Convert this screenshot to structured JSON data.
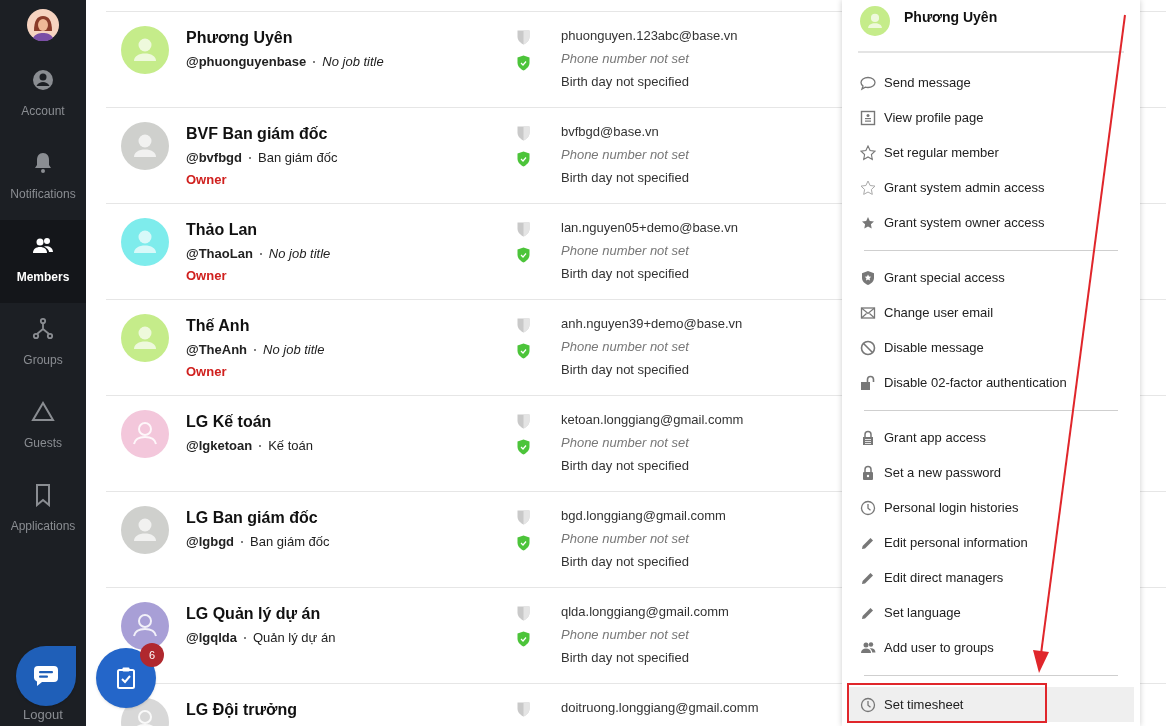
{
  "sidebar": {
    "items": [
      {
        "label": "Account",
        "selected": false
      },
      {
        "label": "Notifications",
        "selected": false
      },
      {
        "label": "Members",
        "selected": true
      },
      {
        "label": "Groups",
        "selected": false
      },
      {
        "label": "Guests",
        "selected": false
      },
      {
        "label": "Applications",
        "selected": false
      }
    ],
    "logout": "Logout"
  },
  "members": [
    {
      "name": "Phương Uyên",
      "handle": "@phuonguyenbase",
      "job_title": "No job title",
      "job_title_set": false,
      "color": "#c5ec8a",
      "kind": "filled",
      "email": "phuonguyen.123abc@base.vn",
      "phone": "Phone number not set",
      "phone_set": false,
      "birthday": "Birth day not specified"
    },
    {
      "name": "BVF Ban giám đốc",
      "handle": "@bvfbgd",
      "job_title": "Ban giám đốc",
      "job_title_set": true,
      "role": "Owner",
      "color": "#cfd0cd",
      "kind": "filled",
      "email": "bvfbgd@base.vn",
      "phone": "Phone number not set",
      "phone_set": false,
      "birthday": "Birth day not specified"
    },
    {
      "name": "Thảo Lan",
      "handle": "@ThaoLan",
      "job_title": "No job title",
      "job_title_set": false,
      "role": "Owner",
      "color": "#7eecec",
      "kind": "filled",
      "email": "lan.nguyen05+demo@base.vn",
      "phone": "Phone number not set",
      "phone_set": false,
      "birthday": "Birth day not specified"
    },
    {
      "name": "Thế Anh",
      "handle": "@TheAnh",
      "job_title": "No job title",
      "job_title_set": false,
      "role": "Owner",
      "color": "#c5ec8a",
      "kind": "filled",
      "email": "anh.nguyen39+demo@base.vn",
      "phone": "Phone number not set",
      "phone_set": false,
      "birthday": "Birth day not specified"
    },
    {
      "name": "LG Kế toán",
      "handle": "@lgketoan",
      "job_title": "Kế toán",
      "job_title_set": true,
      "color": "#f3c7db",
      "kind": "outline",
      "email": "ketoan.longgiang@gmail.comm",
      "phone": "Phone number not set",
      "phone_set": false,
      "birthday": "Birth day not specified"
    },
    {
      "name": "LG Ban giám đốc",
      "handle": "@lgbgd",
      "job_title": "Ban giám đốc",
      "job_title_set": true,
      "color": "#cfd0cd",
      "kind": "filled",
      "email": "bgd.longgiang@gmail.comm",
      "phone": "Phone number not set",
      "phone_set": false,
      "birthday": "Birth day not specified"
    },
    {
      "name": "LG Quản lý dự án",
      "handle": "@lgqlda",
      "job_title": "Quản lý dự án",
      "job_title_set": true,
      "color": "#a89fd6",
      "kind": "outline",
      "email": "qlda.longgiang@gmail.comm",
      "phone": "Phone number not set",
      "phone_set": false,
      "birthday": "Birth day not specified"
    },
    {
      "name": "LG Đội trưởng",
      "color": "#d8d8d8",
      "kind": "outline",
      "email": "doitruong.longgiang@gmail.comm"
    }
  ],
  "menu": {
    "name": "Phương Uyên",
    "color": "#c5ec8a",
    "groups": [
      [
        {
          "label": "Send message",
          "selected": false
        },
        {
          "label": "View profile page",
          "selected": false
        },
        {
          "label": "Set regular member",
          "selected": false
        },
        {
          "label": "Grant system admin access",
          "selected": false
        },
        {
          "label": "Grant system owner access",
          "selected": false
        }
      ],
      [
        {
          "label": "Grant special access",
          "selected": false
        },
        {
          "label": "Change user email",
          "selected": false
        },
        {
          "label": "Disable message",
          "selected": false
        },
        {
          "label": "Disable 02-factor authentication",
          "selected": false
        }
      ],
      [
        {
          "label": "Grant app access",
          "selected": false
        },
        {
          "label": "Set a new password",
          "selected": false
        },
        {
          "label": "Personal login histories",
          "selected": false
        },
        {
          "label": "Edit personal information",
          "selected": false
        },
        {
          "label": "Edit direct managers",
          "selected": false
        },
        {
          "label": "Set language",
          "selected": false
        },
        {
          "label": "Add user to groups",
          "selected": false
        }
      ],
      [
        {
          "label": "Set timesheet",
          "selected": true
        }
      ]
    ]
  },
  "task_button": {
    "badge": "6"
  }
}
